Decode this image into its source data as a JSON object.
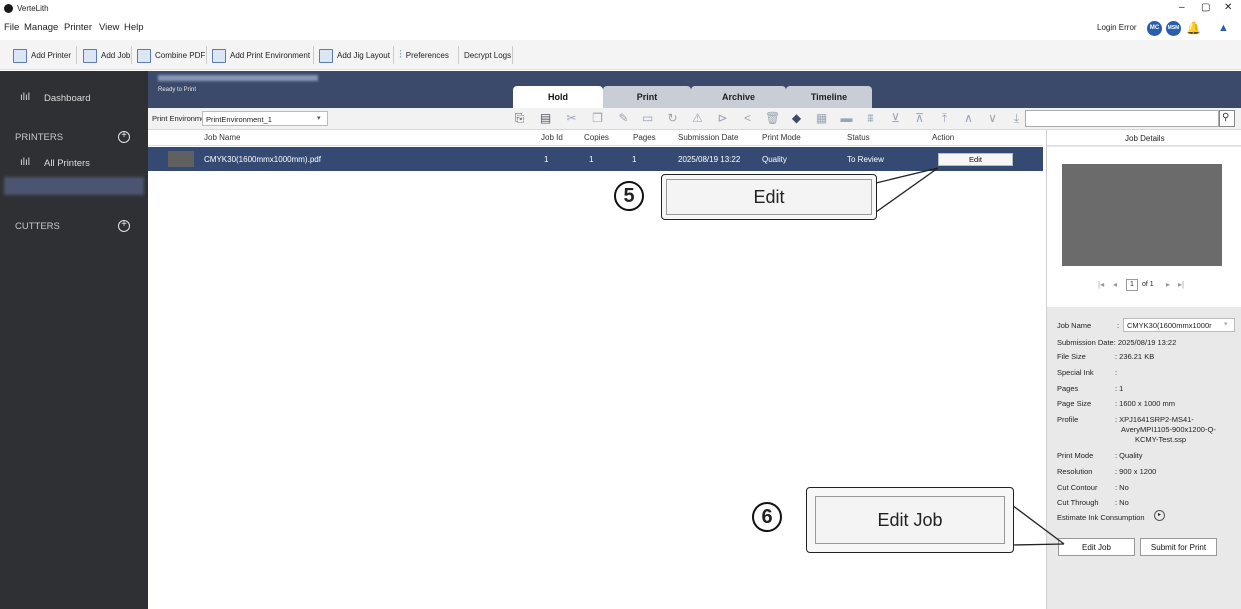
{
  "window": {
    "title": "VerteLith"
  },
  "window_controls": {
    "minimize": "–",
    "restore": "▢",
    "close": "✕"
  },
  "menu": {
    "items": [
      "File",
      "Manage",
      "Printer",
      "View",
      "Help"
    ]
  },
  "account": {
    "status": "Login Error",
    "badge1": "MC",
    "badge2": "MSM"
  },
  "toolbar": {
    "add_printer": "Add Printer",
    "add_job": "Add Job",
    "combine_pdf": "Combine PDF",
    "add_print_env": "Add Print Environment",
    "add_jig": "Add Jig Layout",
    "preferences": "Preferences",
    "decrypt_logs": "Decrypt Logs"
  },
  "sidebar": {
    "dashboard": "Dashboard",
    "printers_heading": "PRINTERS",
    "all_printers": "All Printers",
    "cutters_heading": "CUTTERS"
  },
  "printer_header": {
    "status": "Ready to Print"
  },
  "tabs": [
    "Hold",
    "Print",
    "Archive",
    "Timeline"
  ],
  "filter": {
    "label": "Print Environment",
    "value": "PrintEnvironment_1"
  },
  "table": {
    "headers": [
      "Job Name",
      "Job Id",
      "Copies",
      "Pages",
      "Submission Date",
      "Print Mode",
      "Status",
      "Action"
    ],
    "rows": [
      {
        "name": "CMYK30(1600mmx1000mm).pdf",
        "id": "1",
        "copies": "1",
        "pages": "1",
        "date": "2025/08/19 13:22",
        "mode": "Quality",
        "status": "To Review",
        "action": "Edit"
      }
    ]
  },
  "details": {
    "heading": "Job Details",
    "pager": {
      "current": "1",
      "of_label": "of 1"
    },
    "job_name_label": "Job Name",
    "job_name_value": "CMYK30(1600mmx1000r",
    "fields": [
      {
        "label": "Submission Date",
        "value": ": 2025/08/19 13:22"
      },
      {
        "label": "File Size",
        "value": ": 236.21 KB"
      },
      {
        "label": "Special Ink",
        "value": ":"
      },
      {
        "label": "Pages",
        "value": ": 1"
      },
      {
        "label": "Page Size",
        "value": ": 1600 x 1000 mm"
      },
      {
        "label": "Profile",
        "value": ": XPJ1641SRP2-MS41-"
      },
      {
        "label": "",
        "value": "AveryMPI1105-900x1200-Q-"
      },
      {
        "label": "",
        "value": "KCMY-Test.ssp"
      },
      {
        "label": "Print Mode",
        "value": ": Quality"
      },
      {
        "label": "Resolution",
        "value": ": 900 x 1200"
      },
      {
        "label": "Cut Contour",
        "value": ": No"
      },
      {
        "label": "Cut Through",
        "value": ": No"
      },
      {
        "label": "Estimate Ink Consumption",
        "value": ""
      }
    ],
    "edit_job": "Edit Job",
    "submit": "Submit for Print"
  },
  "callouts": {
    "edit": {
      "number": "5",
      "label": "Edit"
    },
    "edit_job": {
      "number": "6",
      "label": "Edit Job"
    }
  }
}
